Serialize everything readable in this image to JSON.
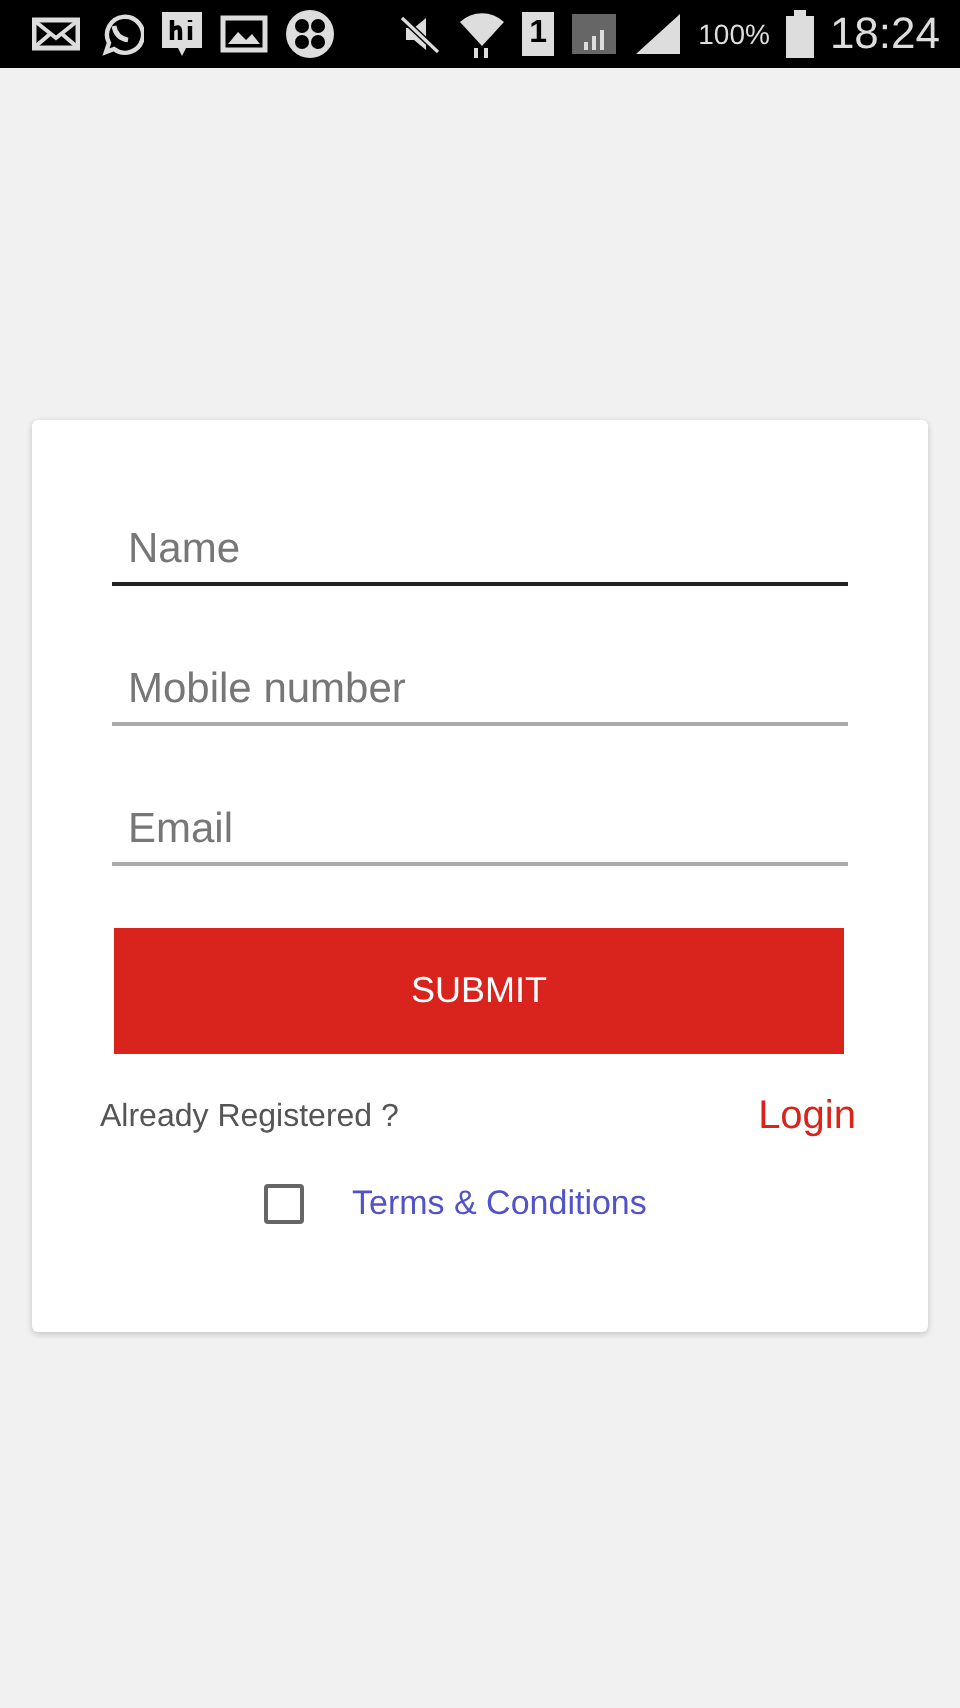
{
  "status_bar": {
    "sim_slot": "1",
    "battery": "100%",
    "time": "18:24"
  },
  "form": {
    "fields": [
      {
        "placeholder": "Name",
        "focused": true
      },
      {
        "placeholder": "Mobile number",
        "focused": false
      },
      {
        "placeholder": "Email",
        "focused": false
      }
    ],
    "submit": "SUBMIT",
    "already_registered": "Already Registered ?",
    "login": "Login",
    "terms": {
      "label": "Terms & Conditions",
      "checked": false
    }
  }
}
